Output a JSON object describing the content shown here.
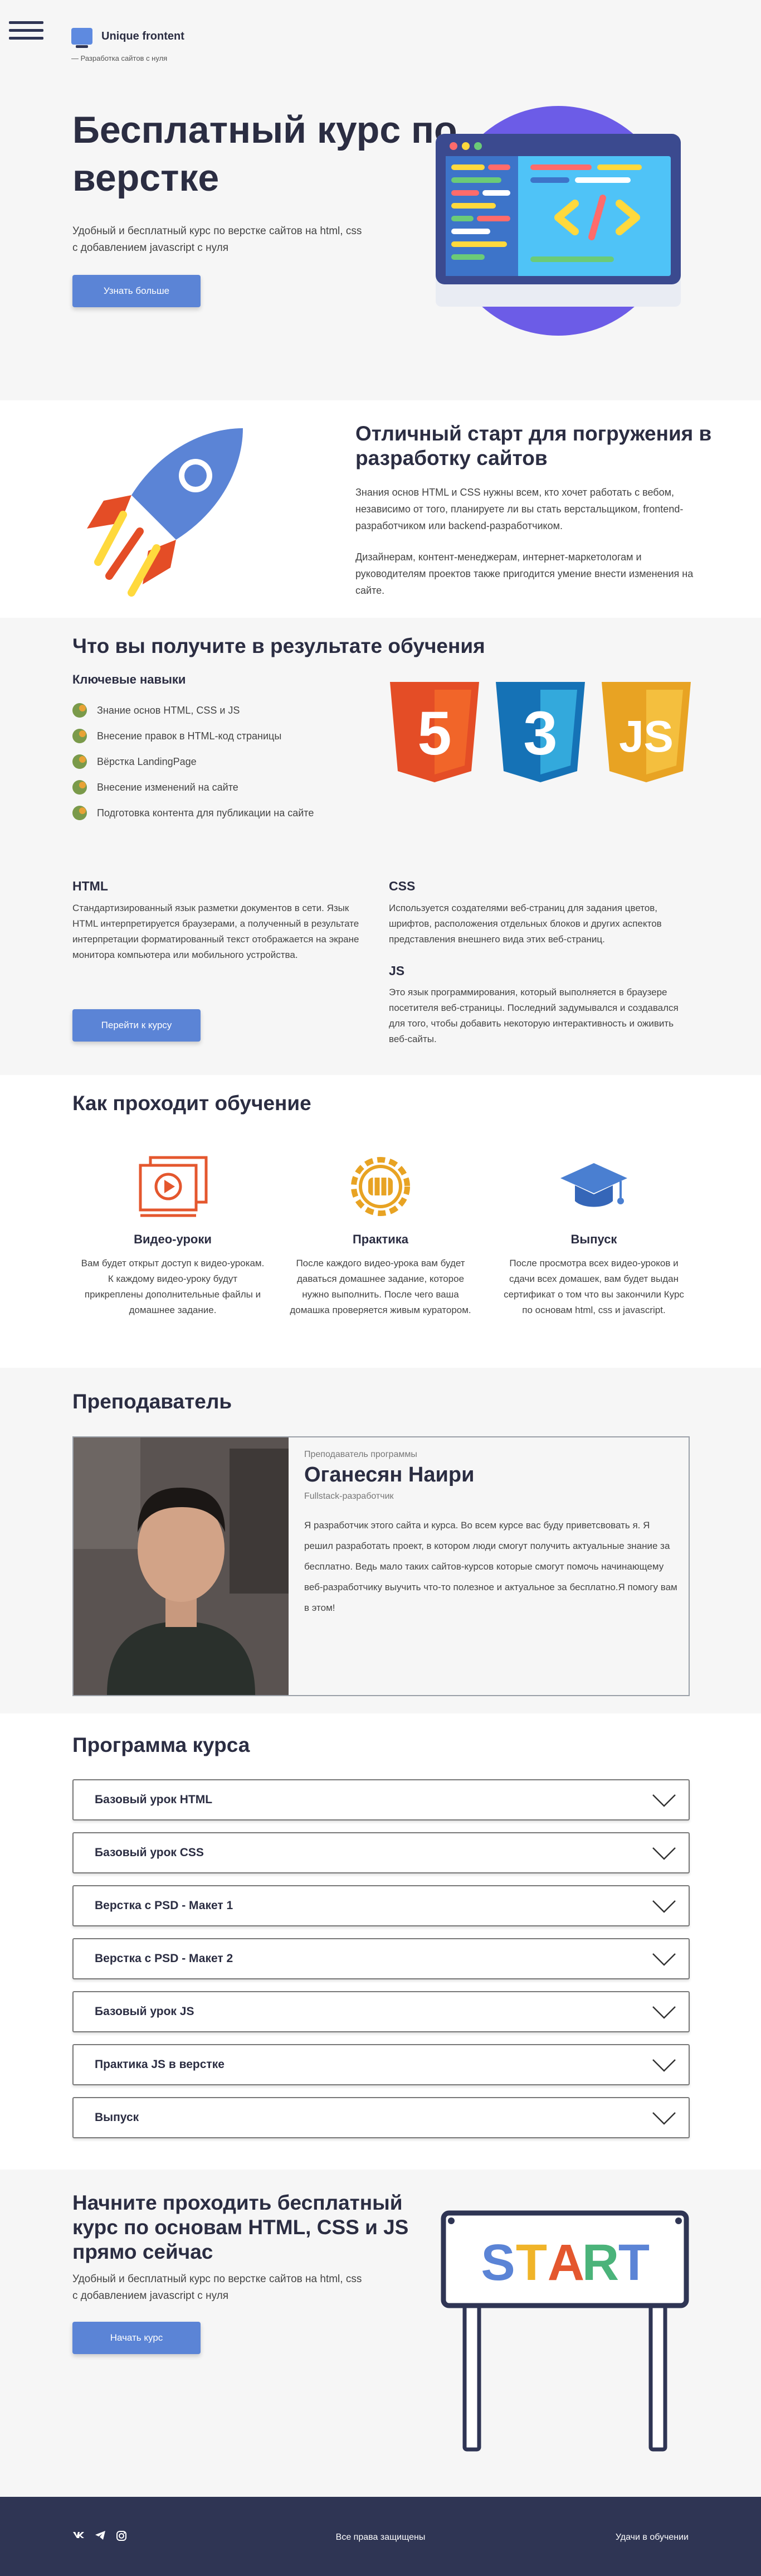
{
  "brand": {
    "title": "Unique frontent",
    "subtitle": "— Разработка сайтов с нуля"
  },
  "hero": {
    "title": "Бесплатный курс по верстке",
    "text": "Удобный и бесплатный курс по верстке сайтов на html, css с добавлением javascript с нуля",
    "button": "Узнать больше"
  },
  "start": {
    "title": "Отличный старт для погружения в разработку сайтов",
    "p1": "Знания основ HTML и CSS нужны всем, кто хочет работать с вебом, независимо от того, планируете ли вы стать верстальщиком, frontend-разработчиком или backend-разработчиком.",
    "p2": "Дизайнерам, контент-менеджерам, интернет-маркетологам и руководителям проектов также пригодится умение внести изменения на сайте."
  },
  "results": {
    "title": "Что вы получите в результате обучения",
    "skills_title": "Ключевые навыки",
    "skills": [
      "Знание основ HTML, CSS и JS",
      "Внесение правок в HTML-код страницы",
      "Вёрстка LandingPage",
      "Внесение изменений на сайте",
      "Подготовка контента для публикации на сайте"
    ],
    "badges": {
      "html": "5",
      "css": "3",
      "js": "JS"
    },
    "html_title": "HTML",
    "html_text": "Стандартизированный язык разметки документов в сети. Язык HTML интерпретируется браузерами, а полученный в результате интерпретации форматированный текст отображается на экране монитора компьютера или мобильного устройства.",
    "css_title": "CSS",
    "css_text": "Используется создателями веб-страниц для задания цветов, шрифтов, расположения отдельных блоков и других аспектов представления внешнего вида этих веб-страниц.",
    "js_title": "JS",
    "js_text": "Это язык программирования, который выполняется в браузере посетителя веб-страницы. Последний задумывался и создавался для того, чтобы добавить некоторую интерактивность и оживить веб-сайты.",
    "button": "Перейти к курсу"
  },
  "process": {
    "title": "Как проходит обучение",
    "steps": [
      {
        "title": "Видео-уроки",
        "text": "Вам будет открыт доступ к видео-урокам. К каждому видео-уроку будут прикреплены дополнительные файлы и домашнее задание."
      },
      {
        "title": "Практика",
        "text": "После каждого видео-урока вам будет даваться домашнее задание, которое нужно выполнить. После чего ваша домашка проверяется живым куратором."
      },
      {
        "title": "Выпуск",
        "text": "После просмотра всех видео-уроков и сдачи всех домашек, вам будет выдан сертификат о том что вы закончили Курс по основам html, css и javascript."
      }
    ]
  },
  "teacher": {
    "title": "Преподаватель",
    "label": "Преподаватель программы",
    "name": "Оганесян Наири",
    "role": "Fullstack-разработчик",
    "bio": "Я разработчик этого сайта и курса. Во всем курсе вас буду приветсвовать я. Я решил разработать проект, в котором люди смогут получить актуальные знание за бесплатно. Ведь мало таких сайтов-курсов которые смогут помочь начинающему веб-разработчику выучить что-то полезное и актуальное за бесплатно.Я помогу вам в этом!"
  },
  "program": {
    "title": "Программа курса",
    "items": [
      "Базовый урок HTML",
      "Базовый урок CSS",
      "Верстка с PSD - Макет 1",
      "Верстка с PSD - Макет 2",
      "Базовый урок JS",
      "Практика JS в верстке",
      "Выпуск"
    ]
  },
  "cta": {
    "title": "Начните проходить бесплатный курс по основам HTML, CSS и JS прямо сейчас",
    "text": "Удобный и бесплатный курс по верстке сайтов на html, css с добавлением javascript с нуля",
    "button": "Начать курс",
    "banner_letters": [
      "S",
      "T",
      "A",
      "R",
      "T"
    ]
  },
  "footer": {
    "rights": "Все права защищены",
    "wish": "Удачи в обучении"
  },
  "colors": {
    "accent": "#5b84d6",
    "dark": "#2f3554",
    "html": "#e44d26",
    "css": "#1572b6",
    "js": "#e8a323"
  }
}
